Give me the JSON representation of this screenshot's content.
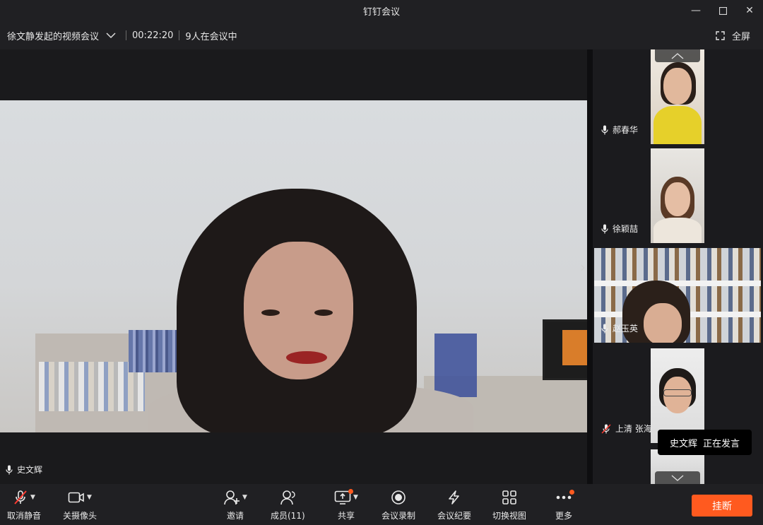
{
  "window": {
    "title": "钉钉会议",
    "minimize_icon": "minimize-icon",
    "maximize_icon": "maximize-icon",
    "close_icon": "close-icon"
  },
  "info": {
    "meeting_title": "徐文静发起的视频会议",
    "duration": "00:22:20",
    "participants": "9人在会议中",
    "fullscreen_label": "全屏"
  },
  "main_video": {
    "speaker_name": "史文辉"
  },
  "sidebar": {
    "tiles": [
      {
        "name": "郝春华",
        "muted": false
      },
      {
        "name": "徐颖喆",
        "muted": false
      },
      {
        "name": "赵玉英",
        "muted": false
      },
      {
        "name": "上清  张海",
        "muted": true
      }
    ]
  },
  "speaking_tip": {
    "name": "史文辉",
    "status": "正在发言"
  },
  "toolbar": {
    "unmute": "取消静音",
    "camera_off": "关摄像头",
    "invite": "邀请",
    "members": "成员(11)",
    "share": "共享",
    "record": "会议录制",
    "minutes": "会议纪要",
    "switch_view": "切换视图",
    "more": "更多",
    "hangup": "挂断"
  },
  "colors": {
    "accent": "#ff5a1f",
    "bar_bg": "#202023",
    "panel_bg": "#1b1b1e"
  }
}
